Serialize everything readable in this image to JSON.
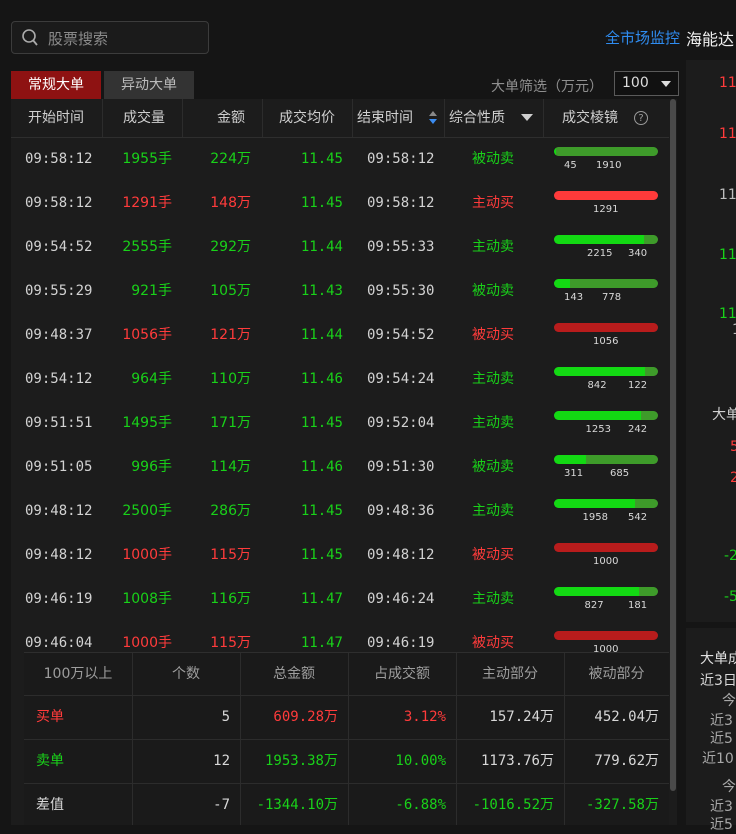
{
  "search": {
    "placeholder": "股票搜索"
  },
  "top": {
    "market_monitor": "全市场监控",
    "stock_name": "海能达"
  },
  "tabs": [
    {
      "label": "常规大单"
    },
    {
      "label": "异动大单"
    }
  ],
  "filter": {
    "label": "大单筛选（万元）",
    "value": "100"
  },
  "table": {
    "headers": {
      "start": "开始时间",
      "volume": "成交量",
      "amount": "金额",
      "avg_price": "成交均价",
      "end": "结束时间",
      "nature": "综合性质",
      "prism": "成交棱镜",
      "help": "?"
    },
    "rows": [
      {
        "start": "09:58:12",
        "volume": "1955手",
        "amount": "224万",
        "price": "11.45",
        "end": "09:58:12",
        "nature": "被动卖",
        "color": "green",
        "buy": 45,
        "sell": 1910,
        "buy_label": "45",
        "sell_label": "1910"
      },
      {
        "start": "09:58:12",
        "volume": "1291手",
        "amount": "148万",
        "price": "11.45",
        "end": "09:58:12",
        "nature": "主动买",
        "color": "red",
        "buy": 1291,
        "sell": 0,
        "buy_label": "1291",
        "sell_label": ""
      },
      {
        "start": "09:54:52",
        "volume": "2555手",
        "amount": "292万",
        "price": "11.44",
        "end": "09:55:33",
        "nature": "主动卖",
        "color": "green",
        "buy": 2215,
        "sell": 340,
        "buy_label": "2215",
        "sell_label": "340"
      },
      {
        "start": "09:55:29",
        "volume": "921手",
        "amount": "105万",
        "price": "11.43",
        "end": "09:55:30",
        "nature": "被动卖",
        "color": "green",
        "buy": 143,
        "sell": 778,
        "buy_label": "143",
        "sell_label": "778"
      },
      {
        "start": "09:48:37",
        "volume": "1056手",
        "amount": "121万",
        "price": "11.44",
        "end": "09:54:52",
        "nature": "被动买",
        "color": "red",
        "buy": 1056,
        "sell": 0,
        "buy_label": "1056",
        "sell_label": ""
      },
      {
        "start": "09:54:12",
        "volume": "964手",
        "amount": "110万",
        "price": "11.46",
        "end": "09:54:24",
        "nature": "主动卖",
        "color": "green",
        "buy": 842,
        "sell": 122,
        "buy_label": "842",
        "sell_label": "122"
      },
      {
        "start": "09:51:51",
        "volume": "1495手",
        "amount": "171万",
        "price": "11.45",
        "end": "09:52:04",
        "nature": "主动卖",
        "color": "green",
        "buy": 1253,
        "sell": 242,
        "buy_label": "1253",
        "sell_label": "242"
      },
      {
        "start": "09:51:05",
        "volume": "996手",
        "amount": "114万",
        "price": "11.46",
        "end": "09:51:30",
        "nature": "被动卖",
        "color": "green",
        "buy": 311,
        "sell": 685,
        "buy_label": "311",
        "sell_label": "685"
      },
      {
        "start": "09:48:12",
        "volume": "2500手",
        "amount": "286万",
        "price": "11.45",
        "end": "09:48:36",
        "nature": "主动卖",
        "color": "green",
        "buy": 1958,
        "sell": 542,
        "buy_label": "1958",
        "sell_label": "542"
      },
      {
        "start": "09:48:12",
        "volume": "1000手",
        "amount": "115万",
        "price": "11.45",
        "end": "09:48:12",
        "nature": "被动买",
        "color": "red",
        "buy": 1000,
        "sell": 0,
        "buy_label": "1000",
        "sell_label": ""
      },
      {
        "start": "09:46:19",
        "volume": "1008手",
        "amount": "116万",
        "price": "11.47",
        "end": "09:46:24",
        "nature": "主动卖",
        "color": "green",
        "buy": 827,
        "sell": 181,
        "buy_label": "827",
        "sell_label": "181"
      },
      {
        "start": "09:46:04",
        "volume": "1000手",
        "amount": "115万",
        "price": "11.47",
        "end": "09:46:19",
        "nature": "被动买",
        "color": "red",
        "buy": 1000,
        "sell": 0,
        "buy_label": "1000",
        "sell_label": ""
      }
    ]
  },
  "summary": {
    "headers": [
      "100万以上",
      "个数",
      "总金额",
      "占成交额",
      "主动部分",
      "被动部分"
    ],
    "rows": [
      {
        "label": "买单",
        "label_color": "red",
        "count": "5",
        "total": "609.28万",
        "pct": "3.12%",
        "active": "157.24万",
        "passive": "452.04万",
        "value_color": "red",
        "part_color": "white"
      },
      {
        "label": "卖单",
        "label_color": "green",
        "count": "12",
        "total": "1953.38万",
        "pct": "10.00%",
        "active": "1173.76万",
        "passive": "779.62万",
        "value_color": "green",
        "part_color": "white"
      },
      {
        "label": "差值",
        "label_color": "white",
        "count": "-7",
        "total": "-1344.10万",
        "pct": "-6.88%",
        "active": "-1016.52万",
        "passive": "-327.58万",
        "value_color": "green",
        "part_color": "green"
      }
    ]
  },
  "right_panel": {
    "prices": [
      {
        "text": "11",
        "color": "red"
      },
      {
        "text": "11",
        "color": "red"
      },
      {
        "text": "11",
        "color": "gray"
      },
      {
        "text": "11",
        "color": "green"
      },
      {
        "text": "11",
        "color": "green"
      },
      {
        "text": "1",
        "color": "gray"
      }
    ],
    "label1": "大单",
    "vals": [
      {
        "text": "5",
        "color": "red"
      },
      {
        "text": "2",
        "color": "red"
      },
      {
        "text": "-2",
        "color": "green"
      },
      {
        "text": "-5",
        "color": "green"
      }
    ],
    "title2": "大单成",
    "sub2": "近3日",
    "list": [
      "今",
      "近3",
      "近5",
      "近10",
      "今",
      "近3",
      "近5"
    ]
  },
  "colors": {
    "buy_bar": "#ff3a3a",
    "passive_buy_bar": "#b81c1c",
    "active_sell_bar": "#13d913",
    "passive_sell_bar": "#3e9b2a",
    "red": "#ff3b3b",
    "green": "#19d119"
  }
}
